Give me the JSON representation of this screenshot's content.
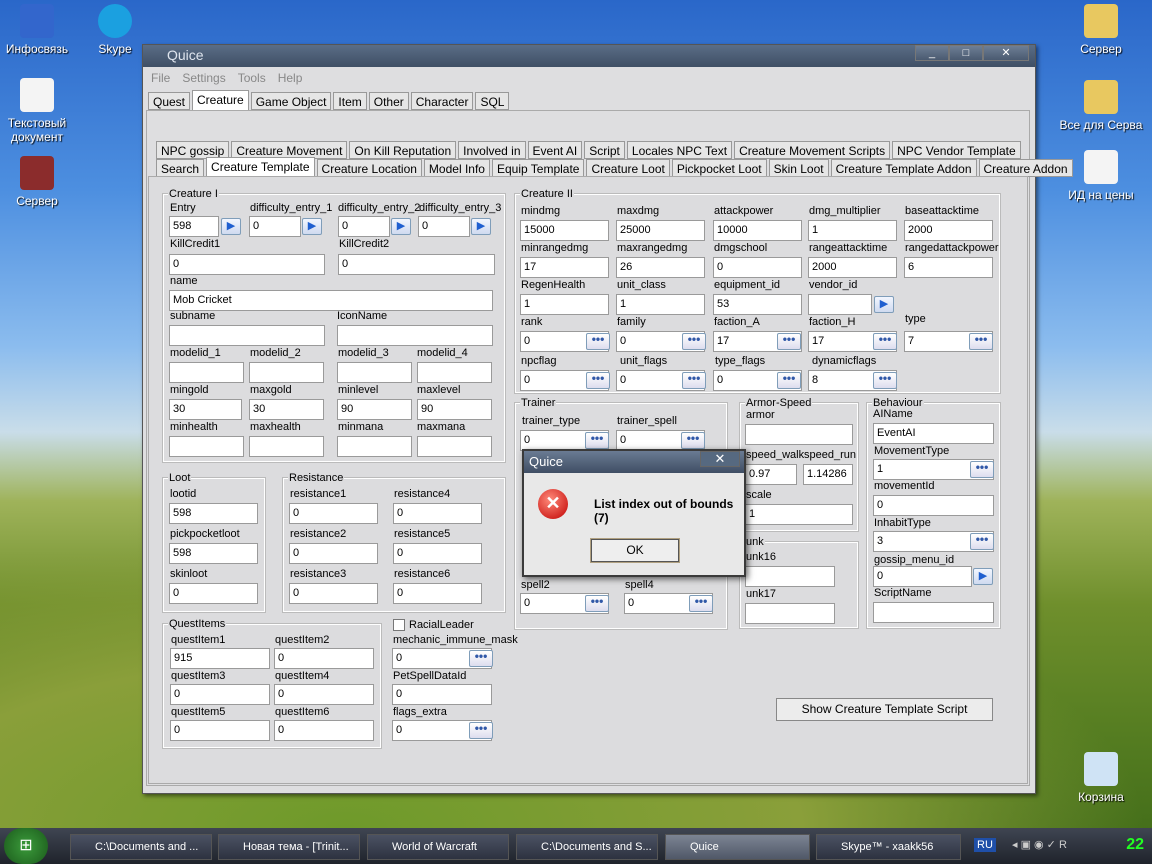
{
  "desktop": {
    "icons": [
      {
        "label": "Инфосвязь",
        "x": "",
        "color": "#3366cc"
      },
      {
        "label": "Skype",
        "color": "#1ba0e0"
      },
      {
        "label": "Текстовый документ",
        "color": "#f4f4f4"
      },
      {
        "label": "Сервер",
        "color": "#8b2c2c"
      },
      {
        "label": "Сервер",
        "color": "#e8c860"
      },
      {
        "label": "Все для Сервa",
        "color": "#e8c860"
      },
      {
        "label": "ИД на цены",
        "color": "#f4f4f4"
      },
      {
        "label": "Корзина",
        "color": "#cfe3f5"
      }
    ]
  },
  "window": {
    "title": "Quice",
    "min": "_",
    "max": "□",
    "close": "✕",
    "menu": [
      "File",
      "Settings",
      "Tools",
      "Help"
    ],
    "main_tabs": [
      "Quest",
      "Creature",
      "Game Object",
      "Item",
      "Other",
      "Character",
      "SQL"
    ],
    "sub_tabs_row1": [
      "NPC gossip",
      "Creature Movement",
      "On Kill Reputation",
      "Involved in",
      "Event AI",
      "Script",
      "Locales NPC Text",
      "Creature Movement Scripts",
      "NPC Vendor Template"
    ],
    "sub_tabs_row2": [
      "Search",
      "Creature Template",
      "Creature Location",
      "Model Info",
      "Equip Template",
      "Creature Loot",
      "Pickpocket Loot",
      "Skin Loot",
      "Creature Template Addon",
      "Creature Addon"
    ]
  },
  "creature1": {
    "title": "Creature I",
    "entry_label": "Entry",
    "entry": "598",
    "diff1_label": "difficulty_entry_1",
    "diff1": "0",
    "diff2_label": "difficulty_entry_2",
    "diff2": "0",
    "diff3_label": "difficulty_entry_3",
    "diff3": "0",
    "killcredit1_label": "KillCredit1",
    "killcredit1": "0",
    "killcredit2_label": "KillCredit2",
    "killcredit2": "0",
    "name_label": "name",
    "name": "Mob Cricket",
    "subname_label": "subname",
    "subname": "",
    "iconname_label": "IconName",
    "iconname": "",
    "modelid1_label": "modelid_1",
    "modelid2_label": "modelid_2",
    "modelid3_label": "modelid_3",
    "modelid4_label": "modelid_4",
    "mingold_label": "mingold",
    "mingold": "30",
    "maxgold_label": "maxgold",
    "maxgold": "30",
    "minlevel_label": "minlevel",
    "minlevel": "90",
    "maxlevel_label": "maxlevel",
    "maxlevel": "90",
    "minhealth_label": "minhealth",
    "maxhealth_label": "maxhealth",
    "minmana_label": "minmana",
    "maxmana_label": "maxmana"
  },
  "creature2": {
    "title": "Creature II",
    "mindmg_label": "mindmg",
    "mindmg": "15000",
    "maxdmg_label": "maxdmg",
    "maxdmg": "25000",
    "attackpower_label": "attackpower",
    "attackpower": "10000",
    "dmgmult_label": "dmg_multiplier",
    "dmgmult": "1",
    "baseattack_label": "baseattacktime",
    "baseattack": "2000",
    "minranged_label": "minrangedmg",
    "minranged": "17",
    "maxranged_label": "maxrangedmg",
    "maxranged": "26",
    "dmgschool_label": "dmgschool",
    "dmgschool": "0",
    "rangeattack_label": "rangeattacktime",
    "rangeattack": "2000",
    "rangedap_label": "rangedattackpower",
    "rangedap": "6",
    "regen_label": "RegenHealth",
    "regen": "1",
    "unitclass_label": "unit_class",
    "unitclass": "1",
    "equip_label": "equipment_id",
    "equip": "53",
    "vendor_label": "vendor_id",
    "vendor": "",
    "rank_label": "rank",
    "rank": "0",
    "family_label": "family",
    "family": "0",
    "factionA_label": "faction_A",
    "factionA": "17",
    "factionH_label": "faction_H",
    "factionH": "17",
    "type_label": "type",
    "type": "7",
    "npcflag_label": "npcflag",
    "npcflag": "0",
    "unitflags_label": "unit_flags",
    "unitflags": "0",
    "typeflags_label": "type_flags",
    "typeflags": "0",
    "dynflags_label": "dynamicflags",
    "dynflags": "8"
  },
  "trainer": {
    "title": "Trainer",
    "type_label": "trainer_type",
    "type": "0",
    "spell_label": "trainer_spell",
    "spell": "0",
    "spell2_label": "spell2",
    "spell2": "0",
    "spell4_label": "spell4",
    "spell4": "0"
  },
  "armor": {
    "title": "Armor-Speed",
    "armor_label": "armor",
    "armor": "",
    "walk_label": "speed_walk",
    "walk": "0.97",
    "run_label": "speed_run",
    "run": "1.14286",
    "scale_label": "scale",
    "scale": "1"
  },
  "unk": {
    "title": "unk",
    "unk16_label": "unk16",
    "unk16": "",
    "unk17_label": "unk17",
    "unk17": ""
  },
  "behaviour": {
    "title": "Behaviour",
    "ainame_label": "AIName",
    "ainame": "EventAI",
    "movetype_label": "MovementType",
    "movetype": "1",
    "moveid_label": "movementId",
    "moveid": "0",
    "inhabit_label": "InhabitType",
    "inhabit": "3",
    "gossip_label": "gossip_menu_id",
    "gossip": "0",
    "script_label": "ScriptName",
    "script": ""
  },
  "loot": {
    "title": "Loot",
    "lootid_label": "lootid",
    "lootid": "598",
    "pickpocket_label": "pickpocketloot",
    "pickpocket": "598",
    "skin_label": "skinloot",
    "skin": "0"
  },
  "resistance": {
    "title": "Resistance",
    "r1_label": "resistance1",
    "r1": "0",
    "r2_label": "resistance2",
    "r2": "0",
    "r3_label": "resistance3",
    "r3": "0",
    "r4_label": "resistance4",
    "r4": "0",
    "r5_label": "resistance5",
    "r5": "0",
    "r6_label": "resistance6",
    "r6": "0"
  },
  "quest": {
    "title": "QuestItems",
    "q1_label": "questItem1",
    "q1": "915",
    "q2_label": "questItem2",
    "q2": "0",
    "q3_label": "questItem3",
    "q3": "0",
    "q4_label": "questItem4",
    "q4": "0",
    "q5_label": "questItem5",
    "q5": "0",
    "q6_label": "questItem6",
    "q6": "0"
  },
  "misc": {
    "racial_label": "RacialLeader",
    "mechanic_label": "mechanic_immune_mask",
    "mechanic": "0",
    "petspell_label": "PetSpellDataId",
    "petspell": "0",
    "flagsextra_label": "flags_extra",
    "flagsextra": "0",
    "script_btn": "Show Creature Template Script"
  },
  "dialog": {
    "title": "Quice",
    "close": "✕",
    "message": "List index out of bounds (7)",
    "ok": "OK"
  },
  "taskbar": {
    "items": [
      "C:\\Documents and ...",
      "Новая тема - [Trinit...",
      "World of Warcraft",
      "C:\\Documents and S...",
      "Quice",
      "Skype™ - xaakk56"
    ],
    "lang": "RU",
    "clock": "22"
  }
}
